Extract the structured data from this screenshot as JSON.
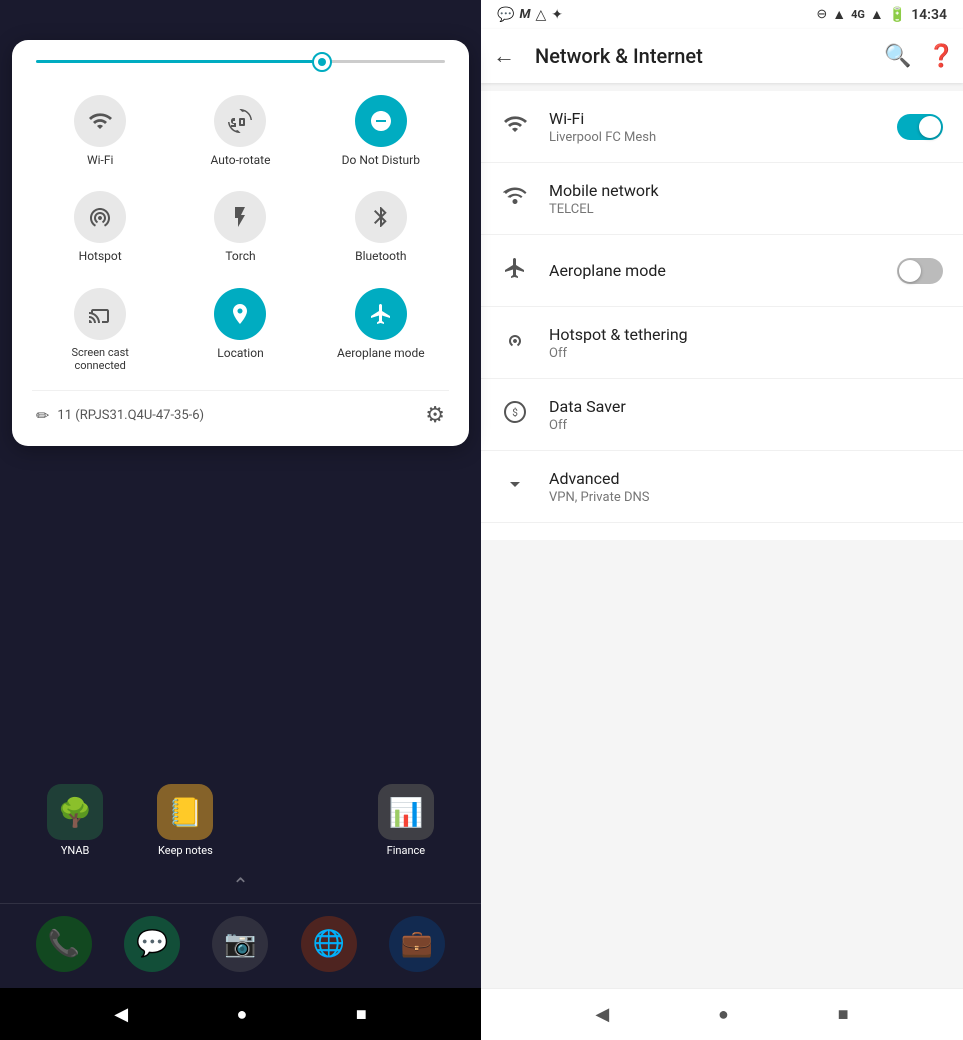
{
  "left": {
    "quick_settings": {
      "brightness_pct": 70,
      "items": [
        {
          "id": "wifi",
          "label": "Wi-Fi",
          "active": false,
          "icon": "wifi"
        },
        {
          "id": "auto-rotate",
          "label": "Auto-rotate",
          "active": false,
          "icon": "rotate"
        },
        {
          "id": "do-not-disturb",
          "label": "Do Not Disturb",
          "active": true,
          "icon": "dnd"
        },
        {
          "id": "hotspot",
          "label": "Hotspot",
          "active": false,
          "icon": "hotspot"
        },
        {
          "id": "torch",
          "label": "Torch",
          "active": false,
          "icon": "torch"
        },
        {
          "id": "bluetooth",
          "label": "Bluetooth",
          "active": false,
          "icon": "bluetooth"
        },
        {
          "id": "screen-cast",
          "label": "Screen cast\nconnected",
          "active": false,
          "icon": "cast"
        },
        {
          "id": "location",
          "label": "Location",
          "active": true,
          "icon": "location"
        },
        {
          "id": "aeroplane",
          "label": "Aeroplane mode",
          "active": true,
          "icon": "aeroplane"
        }
      ],
      "version": "11 (RPJS31.Q4U-47-35-6)",
      "settings_label": "Settings"
    },
    "apps_row1": [
      {
        "id": "ynab",
        "label": "YNAB",
        "emoji": "🌳"
      },
      {
        "id": "keep",
        "label": "Keep notes",
        "emoji": "📒"
      },
      {
        "id": "finance",
        "label": "Finance",
        "emoji": "📊"
      }
    ],
    "dock": [
      {
        "id": "phone",
        "emoji": "📞"
      },
      {
        "id": "whatsapp",
        "emoji": "💬"
      },
      {
        "id": "camera",
        "emoji": "📷"
      },
      {
        "id": "chrome",
        "emoji": "🌐"
      },
      {
        "id": "linkedin",
        "emoji": "💼"
      }
    ],
    "nav": [
      "◀",
      "●",
      "■"
    ]
  },
  "right": {
    "status_bar": {
      "time": "14:34",
      "icons": [
        "💬",
        "M",
        "△",
        "✦"
      ]
    },
    "header": {
      "title": "Network & Internet",
      "back_label": "←"
    },
    "settings_items": [
      {
        "id": "wifi",
        "title": "Wi-Fi",
        "subtitle": "Liverpool FC Mesh",
        "control": "toggle-on",
        "icon": "wifi"
      },
      {
        "id": "mobile-network",
        "title": "Mobile network",
        "subtitle": "TELCEL",
        "control": "none",
        "icon": "signal"
      },
      {
        "id": "aeroplane",
        "title": "Aeroplane mode",
        "subtitle": "",
        "control": "toggle-off",
        "icon": "plane"
      },
      {
        "id": "hotspot",
        "title": "Hotspot & tethering",
        "subtitle": "Off",
        "control": "none",
        "icon": "hotspot"
      },
      {
        "id": "data-saver",
        "title": "Data Saver",
        "subtitle": "Off",
        "control": "none",
        "icon": "datasaver"
      },
      {
        "id": "advanced",
        "title": "Advanced",
        "subtitle": "VPN, Private DNS",
        "control": "expand",
        "icon": "chevron-down"
      }
    ],
    "nav": [
      "◀",
      "●",
      "■"
    ]
  }
}
